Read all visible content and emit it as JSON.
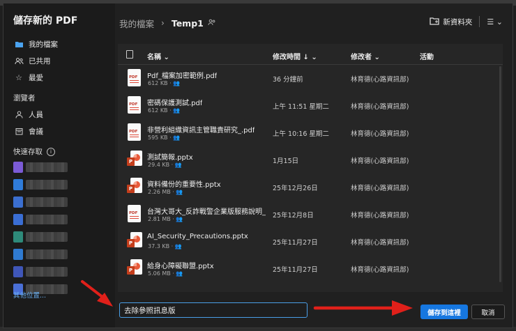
{
  "dialog": {
    "title": "儲存新的 PDF"
  },
  "sidebar": {
    "items": [
      {
        "label": "我的檔案",
        "icon": "folder-icon",
        "active": true
      },
      {
        "label": "已共用",
        "icon": "people-icon",
        "active": false
      },
      {
        "label": "最愛",
        "icon": "star-icon",
        "active": false
      }
    ],
    "browse_label": "瀏覽者",
    "browse_items": [
      {
        "label": "人員",
        "icon": "person-icon"
      },
      {
        "label": "會議",
        "icon": "calendar-icon"
      }
    ],
    "quick_access_label": "快速存取",
    "quick_access_colors": [
      "#7b5bd6",
      "#2f7bd9",
      "#3b6fd0",
      "#3a6ed4",
      "#2e8a7a",
      "#2f7ad0",
      "#3f56b8",
      "#4a6fd6"
    ],
    "other_locations": "其他位置..."
  },
  "header": {
    "crumb_root": "我的檔案",
    "crumb_current": "Temp1",
    "new_folder": "新資料夾"
  },
  "table": {
    "headers": {
      "name": "名稱",
      "modified": "修改時間 ↓",
      "modified_by": "修改者",
      "activity": "活動"
    },
    "rows": [
      {
        "type": "pdf",
        "name": "Pdf_檔案加密範例.pdf",
        "size": "612 KB",
        "modified": "36 分鐘前",
        "by": "林育德(心路資訊部)"
      },
      {
        "type": "pdf",
        "name": "密碼保護測試.pdf",
        "size": "612 KB",
        "modified": "上午 11:51 星期二",
        "by": "林育德(心路資訊部)"
      },
      {
        "type": "pdf",
        "name": "非營利組織資訊主管職責研究_.pdf",
        "size": "595 KB",
        "modified": "上午 10:16 星期二",
        "by": "林育德(心路資訊部)"
      },
      {
        "type": "pptx",
        "name": "測試簡報.pptx",
        "size": "29.4 KB",
        "modified": "1月15日",
        "by": "林育德(心路資訊部)"
      },
      {
        "type": "pptx",
        "name": "資料備份的重要性.pptx",
        "size": "2.26 MB",
        "modified": "25年12月26日",
        "by": "林育德(心路資訊部)"
      },
      {
        "type": "pdf",
        "name": "台灣大哥大_反詐戰警企業版服務說明_...",
        "size": "2.81 MB",
        "modified": "25年12月8日",
        "by": "林育德(心路資訊部)"
      },
      {
        "type": "pptx",
        "name": "AI_Security_Precautions.pptx",
        "size": "37.3 KB",
        "modified": "25年11月27日",
        "by": "林育德(心路資訊部)"
      },
      {
        "type": "pptx",
        "name": "給身心障礙聯盟.pptx",
        "size": "5.06 MB",
        "modified": "25年11月27日",
        "by": "林育德(心路資訊部)"
      }
    ]
  },
  "footer": {
    "filename_value": "去除參照訊息版",
    "save_label": "儲存到這裡",
    "cancel_label": "取消"
  },
  "colors": {
    "accent": "#1677e0",
    "annotation": "#e0201a"
  }
}
